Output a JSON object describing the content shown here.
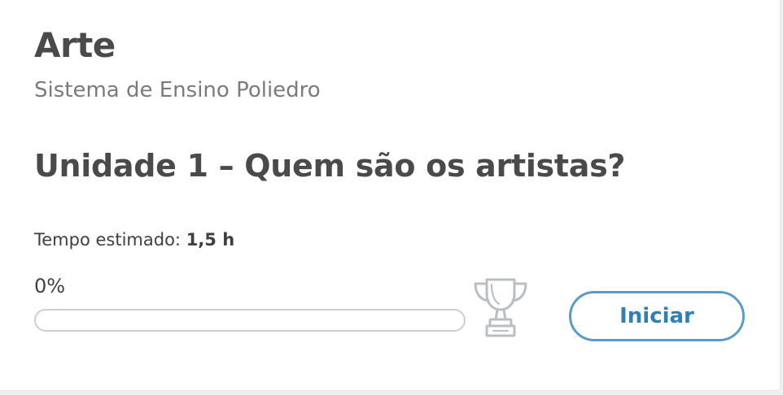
{
  "card": {
    "subject": "Arte",
    "publisher": "Sistema de Ensino Poliedro",
    "unit_title": "Unidade 1 – Quem são os artistas?",
    "time_label": "Tempo estimado:",
    "time_value": "1,5 h",
    "progress_text": "0%",
    "progress_value": 0,
    "trophy_icon": "trophy-icon",
    "start_label": "Iniciar"
  },
  "colors": {
    "accent": "#2f7fb8",
    "button_border": "#5b9bc9",
    "heading": "#4a4a4a",
    "muted": "#7b7b7b",
    "track_border": "#c8d0d4",
    "trophy": "#b8bec2"
  }
}
